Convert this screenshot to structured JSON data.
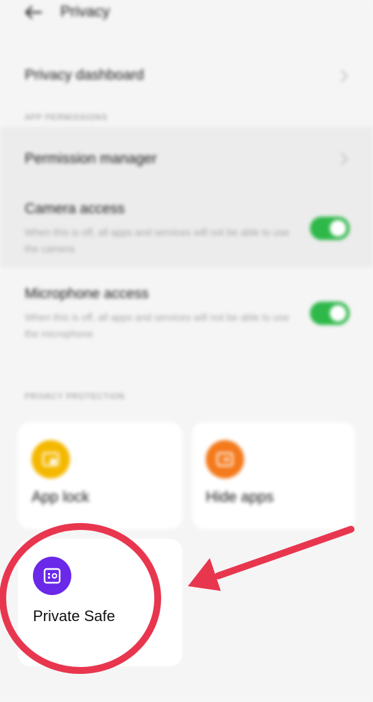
{
  "header": {
    "title": "Privacy",
    "back_icon": "back-arrow-icon"
  },
  "rows": {
    "privacy_dashboard": "Privacy dashboard",
    "permission_manager": "Permission manager"
  },
  "sections": {
    "app_permissions": "APP PERMISSIONS",
    "privacy_protection": "PRIVACY PROTECTION"
  },
  "toggles": {
    "camera": {
      "title": "Camera access",
      "description": "When this is off, all apps and services will not be able to use the camera",
      "state": "on"
    },
    "microphone": {
      "title": "Microphone access",
      "description": "When this is off, all apps and services will not be able to use the microphone",
      "state": "on"
    }
  },
  "cards": {
    "app_lock": {
      "label": "App lock",
      "icon": "lock-icon",
      "color": "#f5b800"
    },
    "hide_apps": {
      "label": "Hide apps",
      "icon": "hide-apps-icon",
      "color": "#f47a1c"
    },
    "private_safe": {
      "label": "Private Safe",
      "icon": "safe-icon",
      "color": "#6a28e8"
    }
  },
  "colors": {
    "toggle_on": "#2fb84a",
    "annotation": "#e8364f",
    "background": "#f6f6f6"
  }
}
